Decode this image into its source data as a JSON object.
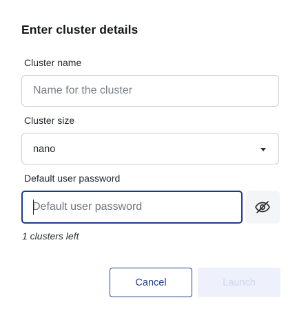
{
  "dialog": {
    "title": "Enter cluster details"
  },
  "cluster_name": {
    "label": "Cluster name",
    "value": "",
    "placeholder": "Name for the cluster"
  },
  "cluster_size": {
    "label": "Cluster size",
    "selected": "nano",
    "icon": "caret-down-icon"
  },
  "password": {
    "label": "Default user password",
    "value": "",
    "placeholder": "Default user password",
    "toggle_icon": "eye-off-icon"
  },
  "hint": "1 clusters left",
  "actions": {
    "cancel_label": "Cancel",
    "launch_label": "Launch",
    "launch_disabled": true
  },
  "colors": {
    "accent": "#1d3b8f",
    "border": "#c9cdd3",
    "disabled_bg": "#eef1fb",
    "disabled_text": "#cfd6ef"
  }
}
